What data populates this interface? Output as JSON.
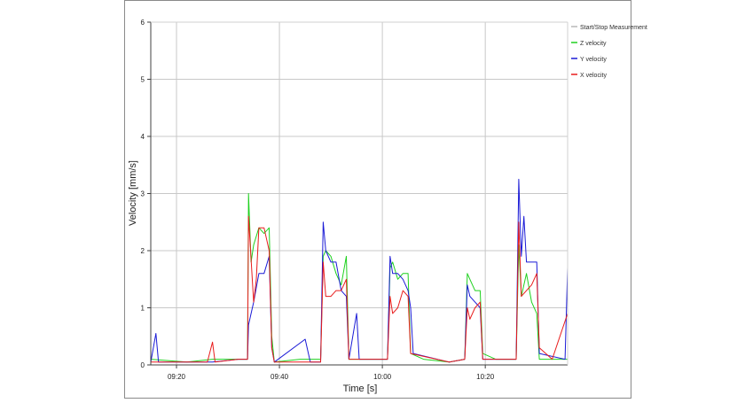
{
  "chart_data": {
    "type": "line",
    "title": "",
    "xlabel": "Time [s]",
    "ylabel": "Velocity [mm/s]",
    "x_range_minutes": [
      "09:15",
      "10:36"
    ],
    "ylim": [
      0,
      6
    ],
    "grid": true,
    "legend_position": "right",
    "x_ticks": [
      "09:20",
      "09:40",
      "10:00",
      "10:20"
    ],
    "y_ticks": [
      "0",
      "1",
      "2",
      "3",
      "4",
      "5",
      "6"
    ],
    "colors": {
      "start_stop": "#b8b8b8",
      "z_velocity": "#1fd11f",
      "y_velocity": "#1a1ad6",
      "x_velocity": "#e81c1c",
      "grid": "#c8c8c8",
      "axis": "#404040"
    },
    "legend": [
      {
        "key": "start_stop",
        "label": "Start/Stop Measurement"
      },
      {
        "key": "z_velocity",
        "label": "Z velocity"
      },
      {
        "key": "y_velocity",
        "label": "Y velocity"
      },
      {
        "key": "x_velocity",
        "label": "X velocity"
      }
    ],
    "series": [
      {
        "name": "Z velocity",
        "key": "z_velocity",
        "points": [
          [
            "09:15",
            0.1
          ],
          [
            "09:22",
            0.05
          ],
          [
            "09:27",
            0.1
          ],
          [
            "09:32",
            0.1
          ],
          [
            "09:33.8",
            0.1
          ],
          [
            "09:34",
            3.0
          ],
          [
            "09:34.5",
            1.8
          ],
          [
            "09:35",
            2.1
          ],
          [
            "09:36",
            2.4
          ],
          [
            "09:37",
            2.3
          ],
          [
            "09:38",
            2.4
          ],
          [
            "09:38.5",
            0.5
          ],
          [
            "09:39",
            0.05
          ],
          [
            "09:44",
            0.1
          ],
          [
            "09:48",
            0.1
          ],
          [
            "09:48.5",
            1.9
          ],
          [
            "09:49",
            2.0
          ],
          [
            "09:50",
            1.9
          ],
          [
            "09:51",
            1.6
          ],
          [
            "09:52",
            1.4
          ],
          [
            "09:53",
            1.9
          ],
          [
            "09:53.5",
            0.1
          ],
          [
            "09:57",
            0.1
          ],
          [
            "10:01",
            0.1
          ],
          [
            "10:01.5",
            1.7
          ],
          [
            "10:02",
            1.8
          ],
          [
            "10:03",
            1.5
          ],
          [
            "10:04",
            1.6
          ],
          [
            "10:05",
            1.6
          ],
          [
            "10:05.5",
            0.2
          ],
          [
            "10:08",
            0.1
          ],
          [
            "10:13",
            0.05
          ],
          [
            "10:16",
            0.1
          ],
          [
            "10:16.5",
            1.6
          ],
          [
            "10:17",
            1.5
          ],
          [
            "10:18",
            1.3
          ],
          [
            "10:19",
            1.3
          ],
          [
            "10:19.5",
            0.2
          ],
          [
            "10:22",
            0.1
          ],
          [
            "10:26",
            0.1
          ],
          [
            "10:26.5",
            2.1
          ],
          [
            "10:27",
            1.2
          ],
          [
            "10:28",
            1.6
          ],
          [
            "10:29",
            1.1
          ],
          [
            "10:30",
            0.9
          ],
          [
            "10:30.5",
            0.1
          ],
          [
            "10:33",
            0.1
          ],
          [
            "10:36",
            0.1
          ]
        ]
      },
      {
        "name": "Y velocity",
        "key": "y_velocity",
        "points": [
          [
            "09:15",
            0.05
          ],
          [
            "09:16",
            0.55
          ],
          [
            "09:16.5",
            0.05
          ],
          [
            "09:22",
            0.05
          ],
          [
            "09:27",
            0.05
          ],
          [
            "09:32",
            0.1
          ],
          [
            "09:33.8",
            0.1
          ],
          [
            "09:34",
            0.7
          ],
          [
            "09:35",
            1.1
          ],
          [
            "09:36",
            1.6
          ],
          [
            "09:37",
            1.6
          ],
          [
            "09:38",
            1.9
          ],
          [
            "09:38.5",
            0.3
          ],
          [
            "09:39",
            0.05
          ],
          [
            "09:45",
            0.45
          ],
          [
            "09:46",
            0.05
          ],
          [
            "09:48",
            0.05
          ],
          [
            "09:48.5",
            2.5
          ],
          [
            "09:49",
            2.0
          ],
          [
            "09:50",
            1.8
          ],
          [
            "09:51",
            1.8
          ],
          [
            "09:52",
            1.3
          ],
          [
            "09:53",
            1.2
          ],
          [
            "09:53.5",
            0.1
          ],
          [
            "09:55",
            0.9
          ],
          [
            "09:55.5",
            0.1
          ],
          [
            "10:01",
            0.1
          ],
          [
            "10:01.5",
            1.9
          ],
          [
            "10:02",
            1.6
          ],
          [
            "10:03",
            1.6
          ],
          [
            "10:04",
            1.5
          ],
          [
            "10:05",
            1.3
          ],
          [
            "10:05.5",
            1.0
          ],
          [
            "10:06",
            0.2
          ],
          [
            "10:13",
            0.05
          ],
          [
            "10:16",
            0.1
          ],
          [
            "10:16.5",
            1.4
          ],
          [
            "10:17",
            1.2
          ],
          [
            "10:18",
            1.1
          ],
          [
            "10:19",
            1.0
          ],
          [
            "10:19.5",
            0.1
          ],
          [
            "10:26",
            0.1
          ],
          [
            "10:26.5",
            3.25
          ],
          [
            "10:27",
            1.9
          ],
          [
            "10:27.5",
            2.6
          ],
          [
            "10:28",
            1.8
          ],
          [
            "10:29",
            1.8
          ],
          [
            "10:30",
            1.8
          ],
          [
            "10:30.5",
            0.2
          ],
          [
            "10:35.5",
            0.1
          ],
          [
            "10:36",
            1.7
          ]
        ]
      },
      {
        "name": "X velocity",
        "key": "x_velocity",
        "points": [
          [
            "09:15",
            0.05
          ],
          [
            "09:22",
            0.05
          ],
          [
            "09:26",
            0.05
          ],
          [
            "09:27",
            0.4
          ],
          [
            "09:27.5",
            0.05
          ],
          [
            "09:32",
            0.1
          ],
          [
            "09:33.8",
            0.1
          ],
          [
            "09:34",
            2.6
          ],
          [
            "09:35",
            1.1
          ],
          [
            "09:35.5",
            1.5
          ],
          [
            "09:36",
            2.4
          ],
          [
            "09:37",
            2.4
          ],
          [
            "09:38",
            2.0
          ],
          [
            "09:38.5",
            0.3
          ],
          [
            "09:39",
            0.05
          ],
          [
            "09:48",
            0.05
          ],
          [
            "09:48.5",
            1.8
          ],
          [
            "09:49",
            1.2
          ],
          [
            "09:50",
            1.2
          ],
          [
            "09:51",
            1.3
          ],
          [
            "09:52",
            1.3
          ],
          [
            "09:53",
            1.5
          ],
          [
            "09:53.5",
            0.1
          ],
          [
            "10:01",
            0.1
          ],
          [
            "10:01.5",
            1.2
          ],
          [
            "10:02",
            0.9
          ],
          [
            "10:03",
            1.0
          ],
          [
            "10:04",
            1.3
          ],
          [
            "10:05",
            1.2
          ],
          [
            "10:05.5",
            0.2
          ],
          [
            "10:13",
            0.05
          ],
          [
            "10:16",
            0.1
          ],
          [
            "10:16.5",
            1.0
          ],
          [
            "10:17",
            0.8
          ],
          [
            "10:18",
            1.0
          ],
          [
            "10:19",
            1.1
          ],
          [
            "10:19.5",
            0.1
          ],
          [
            "10:26",
            0.1
          ],
          [
            "10:26.5",
            2.5
          ],
          [
            "10:27",
            1.2
          ],
          [
            "10:28",
            1.3
          ],
          [
            "10:29",
            1.4
          ],
          [
            "10:30",
            1.6
          ],
          [
            "10:30.5",
            0.3
          ],
          [
            "10:33",
            0.1
          ],
          [
            "10:36",
            0.9
          ]
        ]
      }
    ]
  }
}
